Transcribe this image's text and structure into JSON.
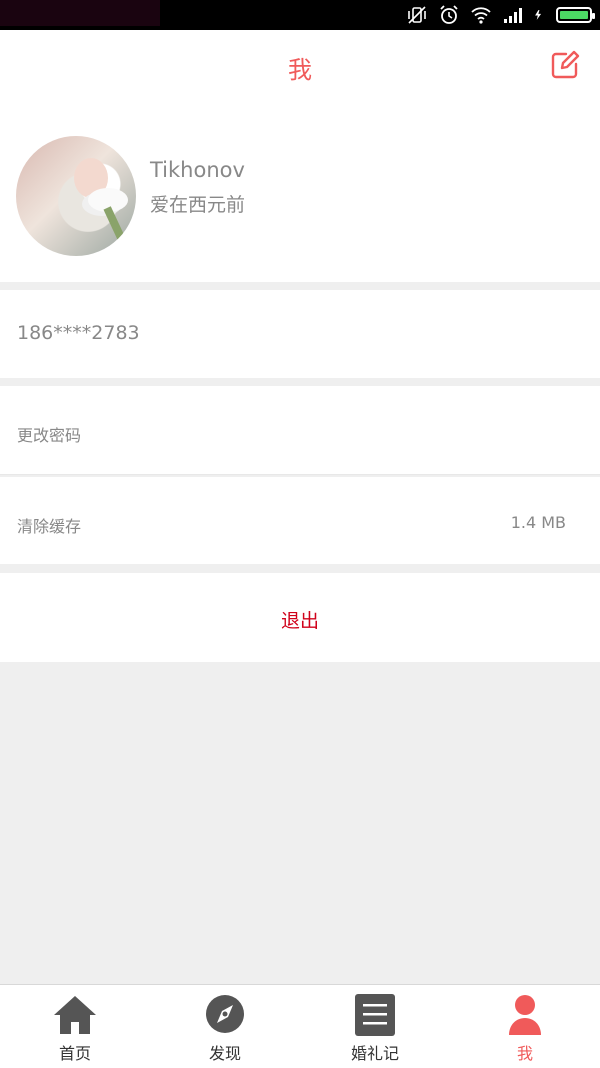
{
  "status_bar": {
    "icons": [
      "vibrate-off-icon",
      "alarm-icon",
      "wifi-icon",
      "signal-icon",
      "charging-icon",
      "battery-icon"
    ]
  },
  "header": {
    "title": "我",
    "edit_icon": "edit-icon",
    "accent_color": "#f05a5a"
  },
  "profile": {
    "name": "Tikhonov",
    "motto": "爱在西元前"
  },
  "account": {
    "phone": "186****2783"
  },
  "settings": {
    "change_password_label": "更改密码",
    "clear_cache_label": "清除缓存",
    "cache_size": "1.4 MB"
  },
  "logout": {
    "label": "退出",
    "color": "#d0021b"
  },
  "tabbar": {
    "tabs": [
      {
        "label": "首页",
        "icon": "home-icon"
      },
      {
        "label": "发现",
        "icon": "compass-icon"
      },
      {
        "label": "婚礼记",
        "icon": "list-icon"
      },
      {
        "label": "我",
        "icon": "person-icon",
        "active": true
      }
    ]
  }
}
